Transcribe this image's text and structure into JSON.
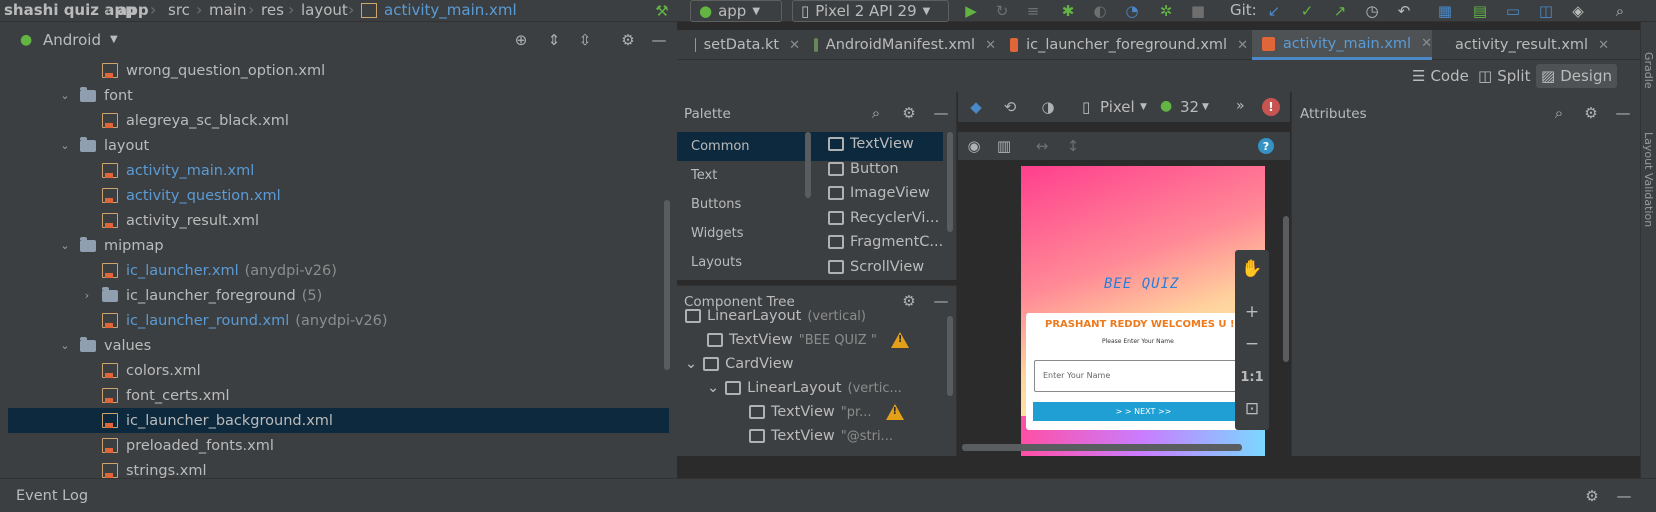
{
  "breadcrumb": {
    "project": "shashi quiz app",
    "module": "app",
    "path": [
      "src",
      "main",
      "res",
      "layout"
    ],
    "file": "activity_main.xml"
  },
  "toolbar": {
    "run_config": "app",
    "device": "Pixel 2 API 29",
    "git_label": "Git:"
  },
  "project_panel": {
    "view_selector": "Android",
    "items": [
      {
        "label": "wrong_question_option.xml",
        "suffix": "",
        "kind": "xml",
        "level": 2,
        "color": "default"
      },
      {
        "label": "font",
        "suffix": "",
        "kind": "folder",
        "level": 1,
        "expanded": true
      },
      {
        "label": "alegreya_sc_black.xml",
        "suffix": "",
        "kind": "xml",
        "level": 2,
        "color": "default"
      },
      {
        "label": "layout",
        "suffix": "",
        "kind": "folder",
        "level": 1,
        "expanded": true
      },
      {
        "label": "activity_main.xml",
        "suffix": "",
        "kind": "xml",
        "level": 2,
        "color": "blue"
      },
      {
        "label": "activity_question.xml",
        "suffix": "",
        "kind": "xml",
        "level": 2,
        "color": "blue"
      },
      {
        "label": "activity_result.xml",
        "suffix": "",
        "kind": "xml",
        "level": 2,
        "color": "default"
      },
      {
        "label": "mipmap",
        "suffix": "",
        "kind": "folder",
        "level": 1,
        "expanded": true
      },
      {
        "label": "ic_launcher.xml",
        "suffix": "(anydpi-v26)",
        "kind": "xml",
        "level": 2,
        "color": "blue"
      },
      {
        "label": "ic_launcher_foreground",
        "suffix": "(5)",
        "kind": "folder",
        "level": 2,
        "expanded": false
      },
      {
        "label": "ic_launcher_round.xml",
        "suffix": "(anydpi-v26)",
        "kind": "xml",
        "level": 2,
        "color": "blue"
      },
      {
        "label": "values",
        "suffix": "",
        "kind": "folder",
        "level": 1,
        "expanded": true
      },
      {
        "label": "colors.xml",
        "suffix": "",
        "kind": "xml",
        "level": 2,
        "color": "default"
      },
      {
        "label": "font_certs.xml",
        "suffix": "",
        "kind": "xml",
        "level": 2,
        "color": "default"
      },
      {
        "label": "ic_launcher_background.xml",
        "suffix": "",
        "kind": "xml",
        "level": 2,
        "color": "default",
        "selected": true
      },
      {
        "label": "preloaded_fonts.xml",
        "suffix": "",
        "kind": "xml",
        "level": 2,
        "color": "default"
      },
      {
        "label": "strings.xml",
        "suffix": "",
        "kind": "xml",
        "level": 2,
        "color": "default"
      }
    ]
  },
  "editor_tabs": [
    {
      "label": "setData.kt",
      "active": false,
      "icon_color": "#a97bff"
    },
    {
      "label": "AndroidManifest.xml",
      "active": false,
      "icon_color": "#6a8759"
    },
    {
      "label": "ic_launcher_foreground.xml",
      "active": false,
      "icon_color": "#e0663a"
    },
    {
      "label": "activity_main.xml",
      "active": true,
      "icon_color": "#e0663a"
    },
    {
      "label": "activity_result.xml",
      "active": false,
      "icon_color": "#e0663a"
    }
  ],
  "view_modes": {
    "code": "Code",
    "split": "Split",
    "design": "Design"
  },
  "palette": {
    "title": "Palette",
    "categories": [
      "Common",
      "Text",
      "Buttons",
      "Widgets",
      "Layouts"
    ],
    "items": [
      "TextView",
      "Button",
      "ImageView",
      "RecyclerVi...",
      "FragmentC...",
      "ScrollView"
    ]
  },
  "design_toolbar": {
    "device": "Pixel",
    "api": "32"
  },
  "component_tree": {
    "title": "Component Tree",
    "nodes": [
      {
        "name": "LinearLayout",
        "detail": "(vertical)",
        "warn": false
      },
      {
        "name": "TextView",
        "detail": "\"BEE QUIZ \"",
        "warn": true
      },
      {
        "name": "CardView",
        "detail": "",
        "warn": false
      },
      {
        "name": "LinearLayout",
        "detail": "(vertic...",
        "warn": false
      },
      {
        "name": "TextView",
        "detail": "\"pr...",
        "warn": true
      },
      {
        "name": "TextView",
        "detail": "\"@stri...",
        "warn": false
      }
    ]
  },
  "preview": {
    "title": "BEE QUIZ",
    "welcome": "PRASHANT REDDY WELCOMES U !!",
    "subtitle": "Please Enter Your Name",
    "input_hint": "Enter Your Name",
    "button": "> > NEXT >>"
  },
  "zoom": {
    "one_to_one": "1:1"
  },
  "attributes": {
    "title": "Attributes"
  },
  "right_strip": {
    "gradle": "Gradle",
    "validation": "Layout Validation"
  },
  "bottom": {
    "event_log": "Event Log"
  },
  "colors": {
    "accent": "#4a88c7",
    "selection": "#0d293e",
    "panel": "#3c3f41",
    "editor": "#2b2b2b"
  }
}
